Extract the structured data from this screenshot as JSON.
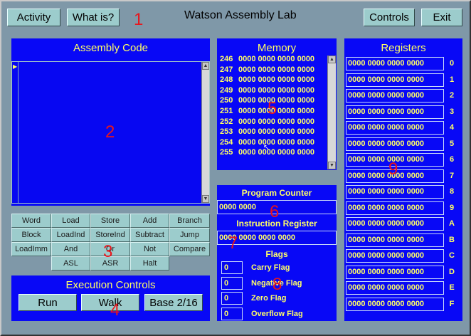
{
  "app_title": "Watson Assembly Lab",
  "header": {
    "activity_label": "Activity",
    "whatis_label": "What is?",
    "controls_label": "Controls",
    "exit_label": "Exit"
  },
  "assembly": {
    "title": "Assembly Code",
    "pointer": "▶"
  },
  "instructions": [
    [
      "Word",
      "Load",
      "Store",
      "Add",
      "Branch"
    ],
    [
      "Block",
      "LoadInd",
      "StoreInd",
      "Subtract",
      "Jump"
    ],
    [
      "LoadImm",
      "And",
      "Or",
      "Not",
      "Compare"
    ],
    [
      "",
      "ASL",
      "ASR",
      "Halt",
      ""
    ]
  ],
  "execution": {
    "title": "Execution Controls",
    "run_label": "Run",
    "walk_label": "Walk",
    "base_label": "Base 2/16"
  },
  "memory": {
    "title": "Memory",
    "rows": [
      {
        "addr": "246",
        "value": "0000 0000 0000 0000"
      },
      {
        "addr": "247",
        "value": "0000 0000 0000 0000"
      },
      {
        "addr": "248",
        "value": "0000 0000 0000 0000"
      },
      {
        "addr": "249",
        "value": "0000 0000 0000 0000"
      },
      {
        "addr": "250",
        "value": "0000 0000 0000 0000"
      },
      {
        "addr": "251",
        "value": "0000 0000 0000 0000"
      },
      {
        "addr": "252",
        "value": "0000 0000 0000 0000"
      },
      {
        "addr": "253",
        "value": "0000 0000 0000 0000"
      },
      {
        "addr": "254",
        "value": "0000 0000 0000 0000"
      },
      {
        "addr": "255",
        "value": "0000 0000 0000 0000"
      }
    ]
  },
  "program_counter": {
    "title": "Program Counter",
    "value": "0000 0000"
  },
  "instruction_register": {
    "title": "Instruction Register",
    "value": "0000 0000 0000 0000"
  },
  "flags": {
    "title": "Flags",
    "items": [
      {
        "value": "0",
        "label": "Carry Flag"
      },
      {
        "value": "0",
        "label": "Negative Flag"
      },
      {
        "value": "0",
        "label": "Zero Flag"
      },
      {
        "value": "0",
        "label": "Overflow Flag"
      }
    ]
  },
  "registers": {
    "title": "Registers",
    "items": [
      {
        "index": "0",
        "value": "0000 0000 0000 0000"
      },
      {
        "index": "1",
        "value": "0000 0000 0000 0000"
      },
      {
        "index": "2",
        "value": "0000 0000 0000 0000"
      },
      {
        "index": "3",
        "value": "0000 0000 0000 0000"
      },
      {
        "index": "4",
        "value": "0000 0000 0000 0000"
      },
      {
        "index": "5",
        "value": "0000 0000 0000 0000"
      },
      {
        "index": "6",
        "value": "0000 0000 0000 0000"
      },
      {
        "index": "7",
        "value": "0000 0000 0000 0000"
      },
      {
        "index": "8",
        "value": "0000 0000 0000 0000"
      },
      {
        "index": "9",
        "value": "0000 0000 0000 0000"
      },
      {
        "index": "A",
        "value": "0000 0000 0000 0000"
      },
      {
        "index": "B",
        "value": "0000 0000 0000 0000"
      },
      {
        "index": "C",
        "value": "0000 0000 0000 0000"
      },
      {
        "index": "D",
        "value": "0000 0000 0000 0000"
      },
      {
        "index": "E",
        "value": "0000 0000 0000 0000"
      },
      {
        "index": "F",
        "value": "0000 0000 0000 0000"
      }
    ]
  },
  "annotations": [
    "1",
    "2",
    "3",
    "4",
    "5",
    "6",
    "7",
    "8",
    "9"
  ],
  "colors": {
    "background": "#7f98a8",
    "panel": "#0808f6",
    "text_yellow": "#ffff66",
    "button": "#9ccccc",
    "annotation_red": "#e8161c"
  }
}
